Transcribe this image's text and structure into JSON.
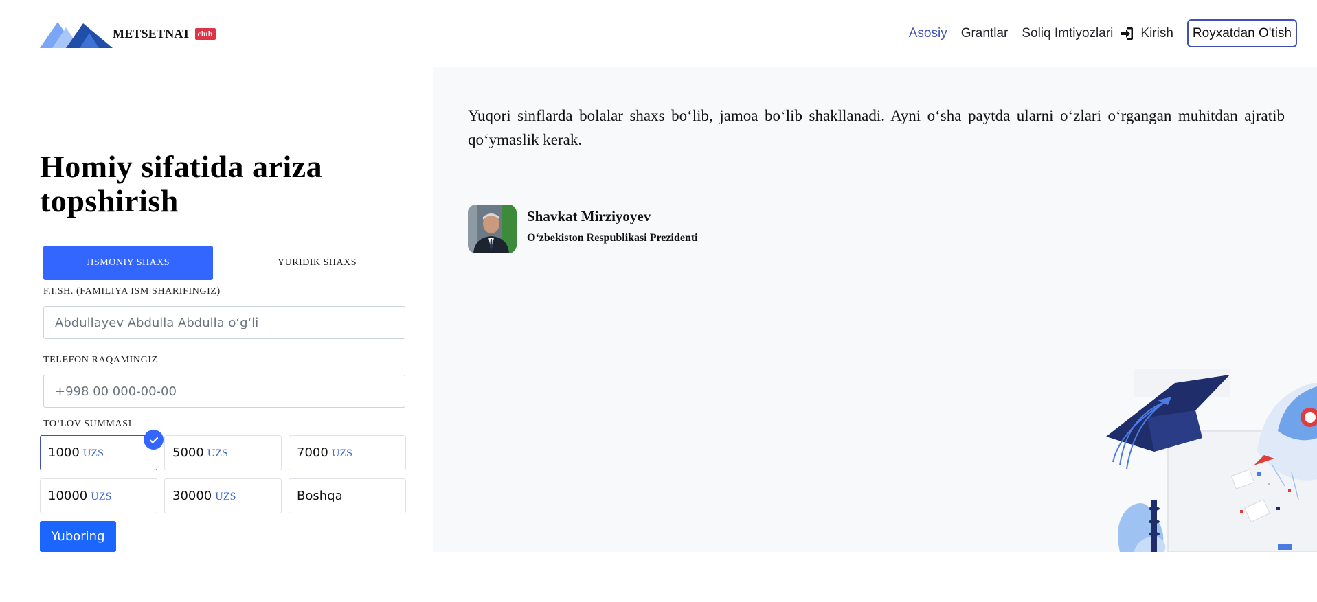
{
  "header": {
    "logo_text": "METSETNAT",
    "logo_badge": "club",
    "nav": [
      {
        "label": "Asosiy",
        "active": true
      },
      {
        "label": "Grantlar",
        "active": false
      },
      {
        "label": "Soliq Imtiyozlari",
        "active": false
      }
    ],
    "login_label": "Kirish",
    "register_label": "Royxatdan O'tish"
  },
  "form": {
    "title": "Homiy sifatida ariza topshirish",
    "tabs": [
      {
        "label": "JISMONIY SHAXS",
        "active": true
      },
      {
        "label": "YURIDIK SHAXS",
        "active": false
      }
    ],
    "name_label": "F.I.SH. (FAMILIYA ISM SHARIFINGIZ)",
    "name_placeholder": "Abdullayev Abdulla Abdulla o‘g‘li",
    "phone_label": "TELEFON RAQAMINGIZ",
    "phone_placeholder": "+998 00 000-00-00",
    "amount_label": "TO‘LOV SUMMASI",
    "currency": "UZS",
    "amounts": [
      "1000",
      "5000",
      "7000",
      "10000",
      "30000"
    ],
    "other_label": "Boshqa",
    "selected_amount": "1000",
    "submit_label": "Yuboring"
  },
  "quote": {
    "text": "Yuqori sinflarda bolalar shaxs bo‘lib, jamoa bo‘lib shakllanadi. Ayni o‘sha paytda ularni o‘zlari o‘rgangan muhitdan ajratib qo‘ymaslik kerak.",
    "author_name": "Shavkat Mirziyoyev",
    "author_role": "O‘zbekiston Respublikasi Prezidenti"
  },
  "colors": {
    "accent": "#3366ff",
    "nav_active": "#3f51b5",
    "badge": "#dc3545",
    "panel_bg": "#f8f9fa",
    "submit": "#1a66ff"
  },
  "icons": {
    "logo": "mountains-logo-icon",
    "login": "sign-in-icon",
    "check": "check-icon"
  }
}
